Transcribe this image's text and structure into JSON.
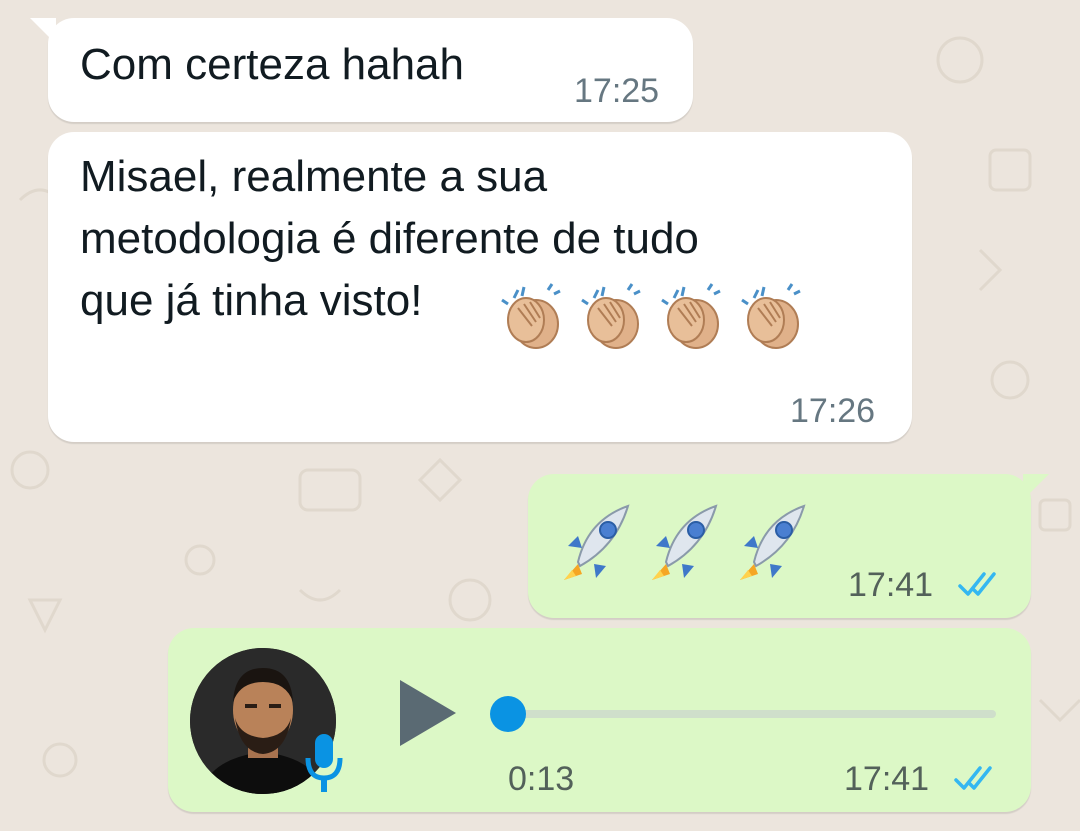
{
  "messages": [
    {
      "direction": "incoming",
      "text": "Com certeza hahah",
      "time": "17:25"
    },
    {
      "direction": "incoming",
      "text": "Misael, realmente a sua\nmetodologia é diferente de tudo\nque já tinha visto!",
      "emoji": "clapping-hands",
      "emoji_count": 4,
      "time": "17:26"
    },
    {
      "direction": "outgoing",
      "emoji": "rocket",
      "emoji_count": 3,
      "time": "17:41",
      "status": "read"
    },
    {
      "direction": "outgoing",
      "type": "voice",
      "duration": "0:13",
      "progress": 0.0,
      "time": "17:41",
      "status": "read"
    }
  ],
  "colors": {
    "incoming_bubble": "#ffffff",
    "outgoing_bubble": "#dcf8c6",
    "read_checks": "#34b7f1",
    "accent": "#0a93e3"
  }
}
